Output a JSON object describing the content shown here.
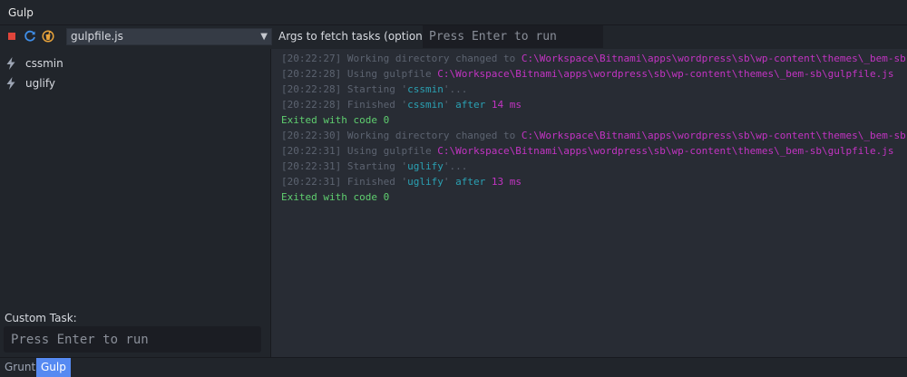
{
  "window": {
    "title": "Gulp"
  },
  "toolbar": {
    "file_select": "gulpfile.js",
    "args_label": "Args to fetch tasks (optional):",
    "args_placeholder": "Press Enter to run"
  },
  "sidebar": {
    "tasks": [
      {
        "label": "cssmin"
      },
      {
        "label": "uglify"
      }
    ],
    "custom_label": "Custom Task:",
    "custom_placeholder": "Press Enter to run"
  },
  "output": {
    "lines": [
      [
        {
          "t": "[20:22:27] ",
          "c": "ts"
        },
        {
          "t": "Working directory changed to ",
          "c": "dim"
        },
        {
          "t": "C:\\Workspace\\Bitnami\\apps\\wordpress\\sb\\wp-content\\themes\\_bem-sb",
          "c": "mag"
        }
      ],
      [
        {
          "t": "[20:22:28] ",
          "c": "ts"
        },
        {
          "t": "Using gulpfile ",
          "c": "dim"
        },
        {
          "t": "C:\\Workspace\\Bitnami\\apps\\wordpress\\sb\\wp-content\\themes\\_bem-sb\\gulpfile.js",
          "c": "mag"
        }
      ],
      [
        {
          "t": "[20:22:28] ",
          "c": "ts"
        },
        {
          "t": "Starting '",
          "c": "dim"
        },
        {
          "t": "cssmin",
          "c": "cyan"
        },
        {
          "t": "'...",
          "c": "dim"
        }
      ],
      [
        {
          "t": "[20:22:28] ",
          "c": "ts"
        },
        {
          "t": "Finished '",
          "c": "dim"
        },
        {
          "t": "cssmin",
          "c": "cyan"
        },
        {
          "t": "' ",
          "c": "dim"
        },
        {
          "t": "after ",
          "c": "cyan"
        },
        {
          "t": "14 ms",
          "c": "mag"
        }
      ],
      [
        {
          "t": "Exited with code 0",
          "c": "green"
        }
      ],
      [
        {
          "t": "[20:22:30] ",
          "c": "ts"
        },
        {
          "t": "Working directory changed to ",
          "c": "dim"
        },
        {
          "t": "C:\\Workspace\\Bitnami\\apps\\wordpress\\sb\\wp-content\\themes\\_bem-sb",
          "c": "mag"
        }
      ],
      [
        {
          "t": "[20:22:31] ",
          "c": "ts"
        },
        {
          "t": "Using gulpfile ",
          "c": "dim"
        },
        {
          "t": "C:\\Workspace\\Bitnami\\apps\\wordpress\\sb\\wp-content\\themes\\_bem-sb\\gulpfile.js",
          "c": "mag"
        }
      ],
      [
        {
          "t": "[20:22:31] ",
          "c": "ts"
        },
        {
          "t": "Starting '",
          "c": "dim"
        },
        {
          "t": "uglify",
          "c": "cyan"
        },
        {
          "t": "'...",
          "c": "dim"
        }
      ],
      [
        {
          "t": "[20:22:31] ",
          "c": "ts"
        },
        {
          "t": "Finished '",
          "c": "dim"
        },
        {
          "t": "uglify",
          "c": "cyan"
        },
        {
          "t": "' ",
          "c": "dim"
        },
        {
          "t": "after ",
          "c": "cyan"
        },
        {
          "t": "13 ms",
          "c": "mag"
        }
      ],
      [
        {
          "t": "Exited with code 0",
          "c": "green"
        }
      ]
    ]
  },
  "statusbar": {
    "tabs": [
      {
        "label": "Grunt",
        "active": false
      },
      {
        "label": "Gulp",
        "active": true
      }
    ]
  },
  "icons": {
    "stop": "stop-icon",
    "refresh": "refresh-icon",
    "gulp": "gulp-icon",
    "task": "lightning-bolt-icon"
  },
  "colors": {
    "stop": "#e0453b",
    "refresh": "#3f8ee8",
    "gulp_logo": "#e8a33b",
    "timestamp": "#5c6370",
    "path": "#c334c3",
    "task_name": "#2aa1b3",
    "success": "#5fce6f",
    "active_tab": "#568af2"
  }
}
